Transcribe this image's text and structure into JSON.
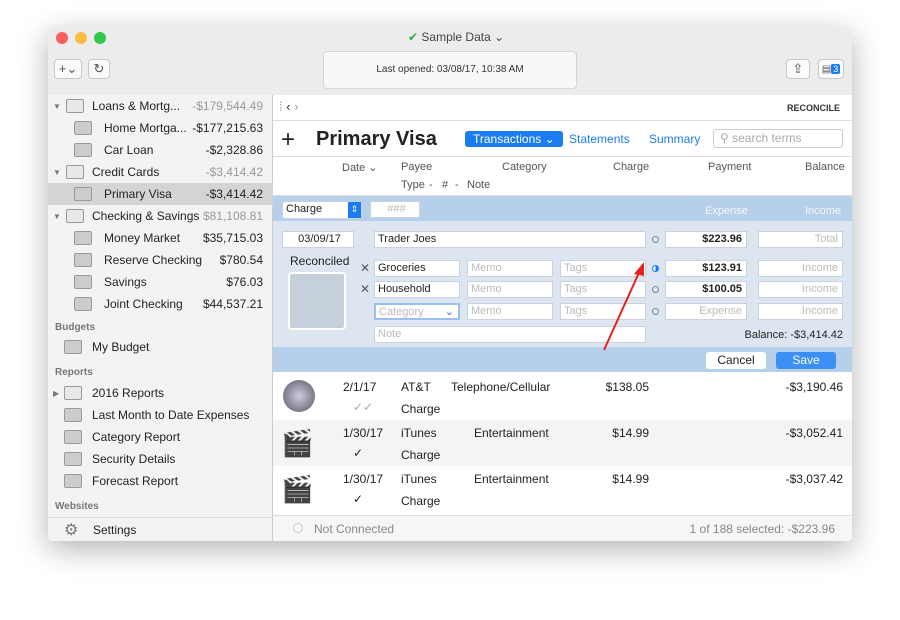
{
  "window": {
    "title": "Sample Data",
    "last_opened": "Last opened:  03/08/17, 10:38 AM",
    "notif_badge": "3"
  },
  "sidebar": {
    "accounts": [
      {
        "name": "Loans & Mortg...",
        "amount": "-$179,544.49",
        "group": true
      },
      {
        "name": "Home Mortga...",
        "amount": "-$177,215.63"
      },
      {
        "name": "Car Loan",
        "amount": "-$2,328.86"
      },
      {
        "name": "Credit Cards",
        "amount": "-$3,414.42",
        "group": true
      },
      {
        "name": "Primary Visa",
        "amount": "-$3,414.42",
        "selected": true
      },
      {
        "name": "Checking & Savings",
        "amount": "$81,108.81",
        "group": true
      },
      {
        "name": "Money Market",
        "amount": "$35,715.03"
      },
      {
        "name": "Reserve Checking",
        "amount": "$780.54"
      },
      {
        "name": "Savings",
        "amount": "$76.03"
      },
      {
        "name": "Joint Checking",
        "amount": "$44,537.21"
      }
    ],
    "budgets_label": "Budgets",
    "budget": "My Budget",
    "reports_label": "Reports",
    "reports": [
      "2016 Reports",
      "Last Month to Date Expenses",
      "Category Report",
      "Security Details",
      "Forecast Report"
    ],
    "websites_label": "Websites",
    "settings": "Settings"
  },
  "main": {
    "reconcile": "RECONCILE",
    "title": "Primary Visa",
    "tabs": [
      "Transactions",
      "Statements",
      "Summary"
    ],
    "search_placeholder": "search terms",
    "columns": {
      "date": "Date",
      "payee": "Payee",
      "category": "Category",
      "type": "Type",
      "num": "#",
      "note": "Note",
      "charge": "Charge",
      "payment": "Payment",
      "balance": "Balance"
    },
    "editor": {
      "type": "Charge",
      "number_placeholder": "###",
      "expense_label": "Expense",
      "income_label": "Income",
      "date": "03/09/17",
      "payee": "Trader Joes",
      "total": "$223.96",
      "total_placeholder": "Total",
      "status": "Reconciled",
      "splits": [
        {
          "category": "Groceries",
          "amount": "$123.91"
        },
        {
          "category": "Household",
          "amount": "$100.05"
        }
      ],
      "memo_placeholder": "Memo",
      "tags_placeholder": "Tags",
      "category_placeholder": "Category",
      "expense_placeholder": "Expense",
      "income_placeholder": "Income",
      "note_placeholder": "Note",
      "balance": "Balance:  -$3,414.42",
      "cancel": "Cancel",
      "save": "Save"
    },
    "transactions": [
      {
        "date": "2/1/17",
        "payee": "AT&T",
        "category": "Telephone/Cellular",
        "type": "Charge",
        "amount": "$138.05",
        "balance": "-$3,190.46",
        "check": "✓✓"
      },
      {
        "date": "1/30/17",
        "payee": "iTunes",
        "category": "Entertainment",
        "type": "Charge",
        "amount": "$14.99",
        "balance": "-$3,052.41",
        "check": "✓"
      },
      {
        "date": "1/30/17",
        "payee": "iTunes",
        "category": "Entertainment",
        "type": "Charge",
        "amount": "$14.99",
        "balance": "-$3,037.42",
        "check": "✓"
      }
    ],
    "status": {
      "connection": "Not Connected",
      "selection": "1 of 188 selected: -$223.96"
    }
  },
  "colors": {
    "accent": "#1a7cf0",
    "editor_bg": "#dde6f0",
    "editor_bar": "#b6cfea"
  }
}
